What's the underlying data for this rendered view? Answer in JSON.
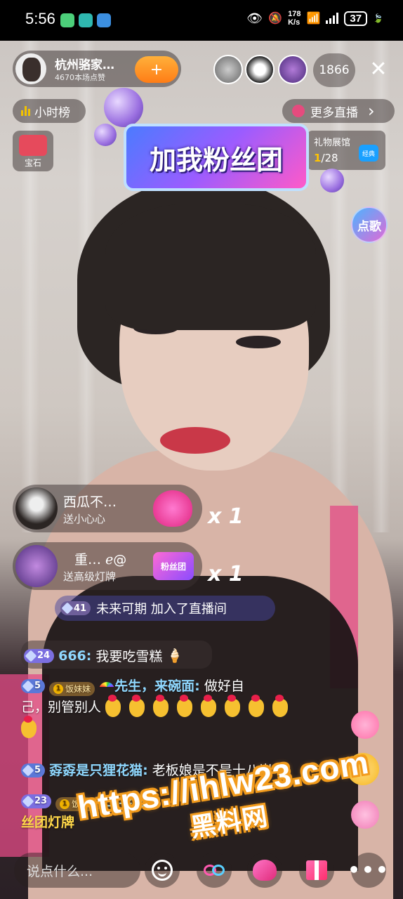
{
  "statusbar": {
    "time": "5:56",
    "speed_value": "178",
    "speed_unit": "K/s",
    "battery": "37"
  },
  "host": {
    "name": "杭州骆家…",
    "likes": "4670本场点赞",
    "follow_symbol": "+"
  },
  "viewers": {
    "count": "1866"
  },
  "close_symbol": "✕",
  "rank": {
    "label": "小时榜"
  },
  "more_live": {
    "label": "更多直播",
    "chevron": "›"
  },
  "treasure": {
    "label": "宝石"
  },
  "gift_hall": {
    "title": "礼物展馆",
    "current": "1",
    "total": "/28",
    "badge": "经典"
  },
  "song": {
    "label": "点歌"
  },
  "banner": {
    "text": "加我粉丝团"
  },
  "gift_notifications": [
    {
      "name": "西瓜不…",
      "action": "送小心心",
      "count": "x 1"
    },
    {
      "name": "重… ℯ@",
      "action": "送高级灯牌",
      "gift_label": "粉丝团",
      "count": "x 1"
    }
  ],
  "join_notice": {
    "level": "41",
    "text": "未来可期 加入了直播间"
  },
  "chat": [
    {
      "level": "24",
      "user": "666:",
      "text": "我要吃雪糕",
      "emoji": "🍦"
    },
    {
      "level": "5",
      "fan_badge": "饭妹妹",
      "user": "先生，来碗面:",
      "text_line1": "做好自",
      "text_line2": "己，别管别人"
    },
    {
      "level": "5",
      "user": "孬孬是只狸花猫:",
      "text": "老板娘是不是十八岁"
    },
    {
      "level": "23",
      "fan_badge": "饭妹妹",
      "user": "玉华花…",
      "text_end": "丝团灯牌"
    }
  ],
  "watermark": {
    "line1": "https://ihlw23.com",
    "line2": "黑料网"
  },
  "bottombar": {
    "input_placeholder": "说点什么...",
    "more": "•••"
  },
  "colors": {
    "follow": "#ff8a1c",
    "username": "#8fd8ff",
    "rank_bar": "#f2c200"
  }
}
